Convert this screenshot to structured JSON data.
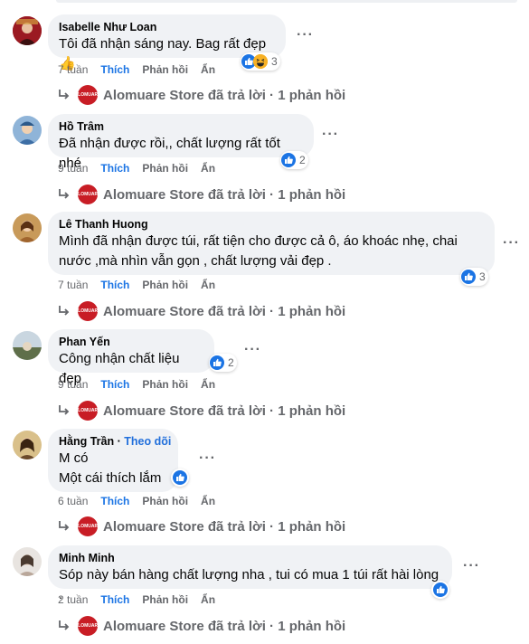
{
  "comments": [
    {
      "author": "Isabelle Như Loan",
      "follow": "",
      "lines": [
        "Tôi đã nhận sáng nay. Bag rất đẹp👍"
      ],
      "time": "7 tuần",
      "reaction_count": "3",
      "reactions": [
        "like-icon",
        "haha-icon"
      ],
      "avatar_color": "#9b1a22"
    },
    {
      "author": "Hồ Trâm",
      "follow": "",
      "lines": [
        "Đã nhận được rồi,, chất lượng rất tốt nhé"
      ],
      "time": "9 tuần",
      "reaction_count": "2",
      "reactions": [
        "like-icon"
      ],
      "avatar_color": "#3d6ea5"
    },
    {
      "author": "Lê Thanh Huong",
      "follow": "",
      "lines": [
        "Mình đã nhận được túi, rất tiện cho được cả ô, áo khoác nhẹ, chai",
        "nước ,mà nhìn vẫn gọn , chất lượng vải đẹp ."
      ],
      "time": "7 tuần",
      "reaction_count": "3",
      "reactions": [
        "like-icon"
      ],
      "avatar_color": "#a0652e"
    },
    {
      "author": "Phan Yến",
      "follow": "",
      "lines": [
        "Công nhận chất liệu đẹp"
      ],
      "time": "9 tuần",
      "reaction_count": "2",
      "reactions": [
        "like-icon"
      ],
      "avatar_color": "#7a8a6a"
    },
    {
      "author": "Hằng Trần",
      "follow": "Theo dõi",
      "lines": [
        "M có",
        "Một cái thích lắm"
      ],
      "time": "6 tuần",
      "reaction_count": "",
      "reactions": [
        "like-icon"
      ],
      "avatar_color": "#6b4a2a"
    },
    {
      "author": "Minh Minh",
      "follow": "",
      "lines": [
        "Sóp này bán hàng chất lượng nha , tui có mua 1 túi rất hài lòng ."
      ],
      "time": "2 tuần",
      "reaction_count": "",
      "reactions": [
        "like-icon"
      ],
      "avatar_color": "#b9a79a"
    }
  ],
  "actions": {
    "like": "Thích",
    "reply": "Phản hồi",
    "hide": "Ẩn"
  },
  "store_reply": {
    "text": "Alomuare Store đã trả lời · 1 phản hồi",
    "logo_text": "ALOMUARE"
  },
  "colors": {
    "accent": "#1b74e4",
    "bubble": "#f0f2f5",
    "muted": "#65676b",
    "store": "#c81d25"
  }
}
